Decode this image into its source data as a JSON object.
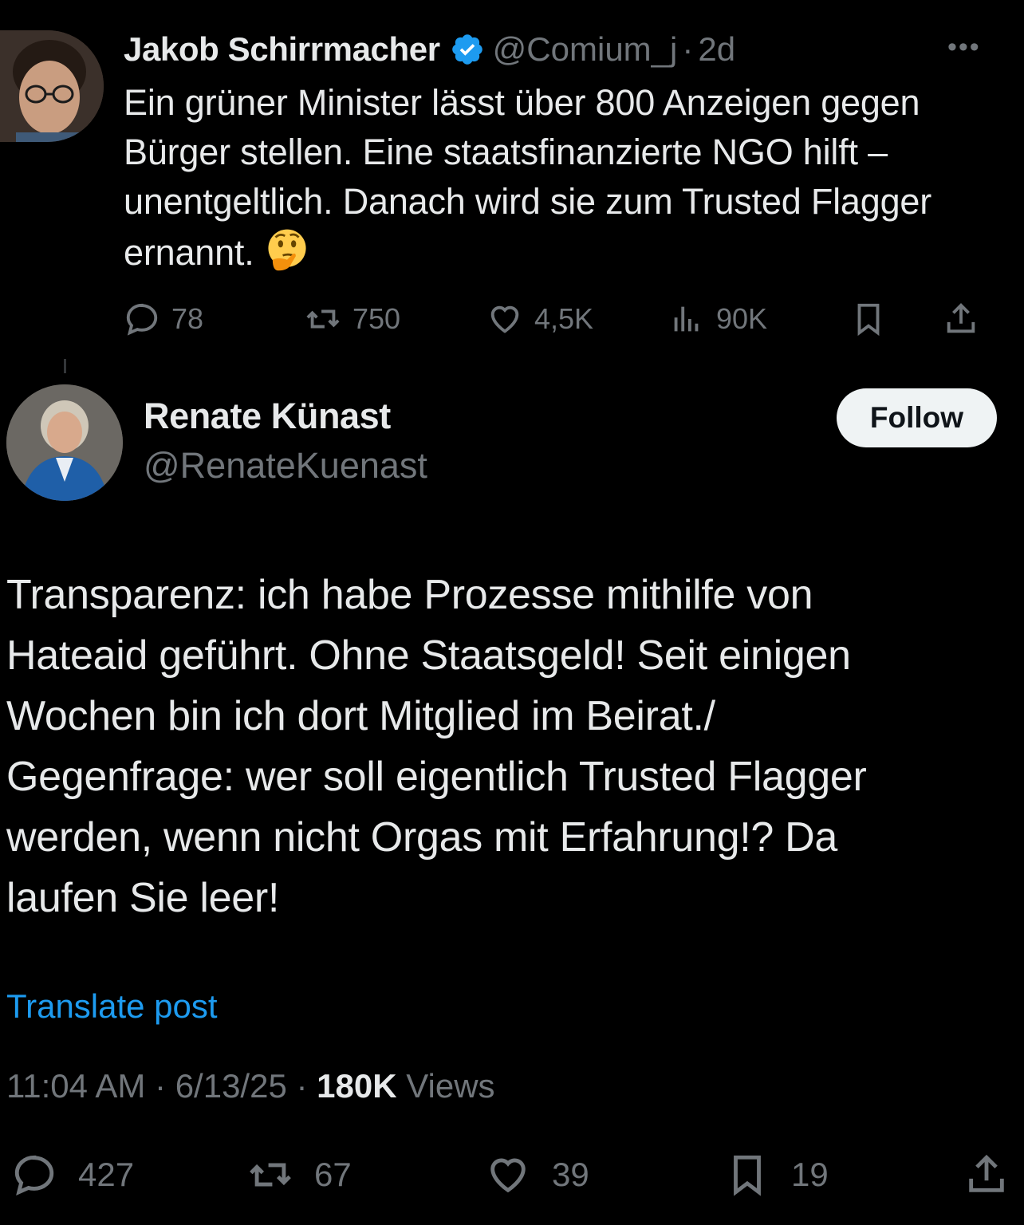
{
  "parent_tweet": {
    "author_name": "Jakob Schirrmacher",
    "handle": "@Comium_j",
    "separator": "·",
    "time_ago": "2d",
    "more_label": "•••",
    "text": "Ein grüner Minister lässt über 800 Anzeigen gegen Bürger stellen. Eine staatsfinanzierte NGO hilft – unentgeltlich. Danach wird sie zum Trusted Flagger ernannt.",
    "emoji": "thinking-face",
    "verified": true,
    "stats": {
      "replies": "78",
      "reposts": "750",
      "likes": "4,5K",
      "views": "90K"
    }
  },
  "main_tweet": {
    "author_name": "Renate Künast",
    "handle": "@RenateKuenast",
    "follow_label": "Follow",
    "text": "Transparenz: ich habe Prozesse mithilfe von\nHateaid geführt. Ohne Staatsgeld! Seit einigen\nWochen bin ich dort Mitglied im Beirat./\nGegenfrage: wer soll eigentlich Trusted Flagger\nwerden, wenn nicht Orgas  mit Erfahrung!? Da\nlaufen Sie leer!",
    "translate_label": "Translate post",
    "time": "11:04 AM",
    "date": "6/13/25",
    "separator": "·",
    "views_count": "180K",
    "views_label": "Views",
    "stats": {
      "replies": "427",
      "reposts": "67",
      "likes": "39",
      "bookmarks": "19"
    }
  },
  "colors": {
    "background": "#000000",
    "text_primary": "#e7e9ea",
    "text_secondary": "#71767b",
    "link": "#1d9bf0",
    "verified": "#1d9bf0",
    "follow_bg": "#eff3f4"
  }
}
